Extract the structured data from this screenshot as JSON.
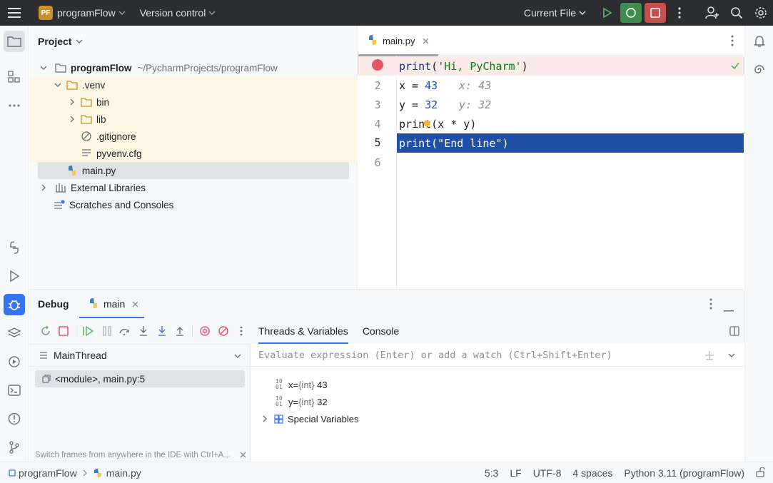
{
  "titlebar": {
    "project_initials": "PF",
    "project_name": "programFlow",
    "vcs_label": "Version control",
    "run_config": "Current File"
  },
  "project_panel": {
    "title": "Project",
    "tree": [
      {
        "label": "programFlow",
        "path": "~/PycharmProjects/programFlow"
      },
      {
        "label": ".venv"
      },
      {
        "label": "bin"
      },
      {
        "label": "lib"
      },
      {
        "label": ".gitignore"
      },
      {
        "label": "pyvenv.cfg"
      },
      {
        "label": "main.py"
      },
      {
        "label": "External Libraries"
      },
      {
        "label": "Scratches and Consoles"
      }
    ]
  },
  "editor": {
    "tab_label": "main.py",
    "line_numbers": [
      "",
      "2",
      "3",
      "4",
      "5",
      "6"
    ],
    "inline_values": {
      "x": "x: 43",
      "y": "y: 32"
    },
    "code": {
      "l1_fn": "print",
      "l1_open": "(",
      "l1_str": "'Hi, PyCharm'",
      "l1_close": ")",
      "l2_a": "x = ",
      "l2_num": "43",
      "l3_a": "y = ",
      "l3_num": "32",
      "l4": "print(x * y)",
      "l5": "print(\"End line\")"
    }
  },
  "debug": {
    "title": "Debug",
    "session_tab": "main",
    "thread": "MainThread",
    "frame": "<module>, main.py:5",
    "hint": "Switch frames from anywhere in the IDE with Ctrl+A...",
    "tabs": {
      "vars": "Threads & Variables",
      "console": "Console"
    },
    "eval_placeholder": "Evaluate expression (Enter) or add a watch (Ctrl+Shift+Enter)",
    "variables": [
      {
        "name": "x",
        "eq": " = ",
        "type": "{int}",
        "value": "43"
      },
      {
        "name": "y",
        "eq": " = ",
        "type": "{int}",
        "value": "32"
      }
    ],
    "special": "Special Variables"
  },
  "statusbar": {
    "project": "programFlow",
    "file": "main.py",
    "position": "5:3",
    "line_sep": "LF",
    "encoding": "UTF-8",
    "indent": "4 spaces",
    "interpreter": "Python 3.11 (programFlow)"
  },
  "colors": {
    "accent": "#3574f0",
    "execution_line": "#214fa5",
    "breakpoint": "#e55765"
  }
}
